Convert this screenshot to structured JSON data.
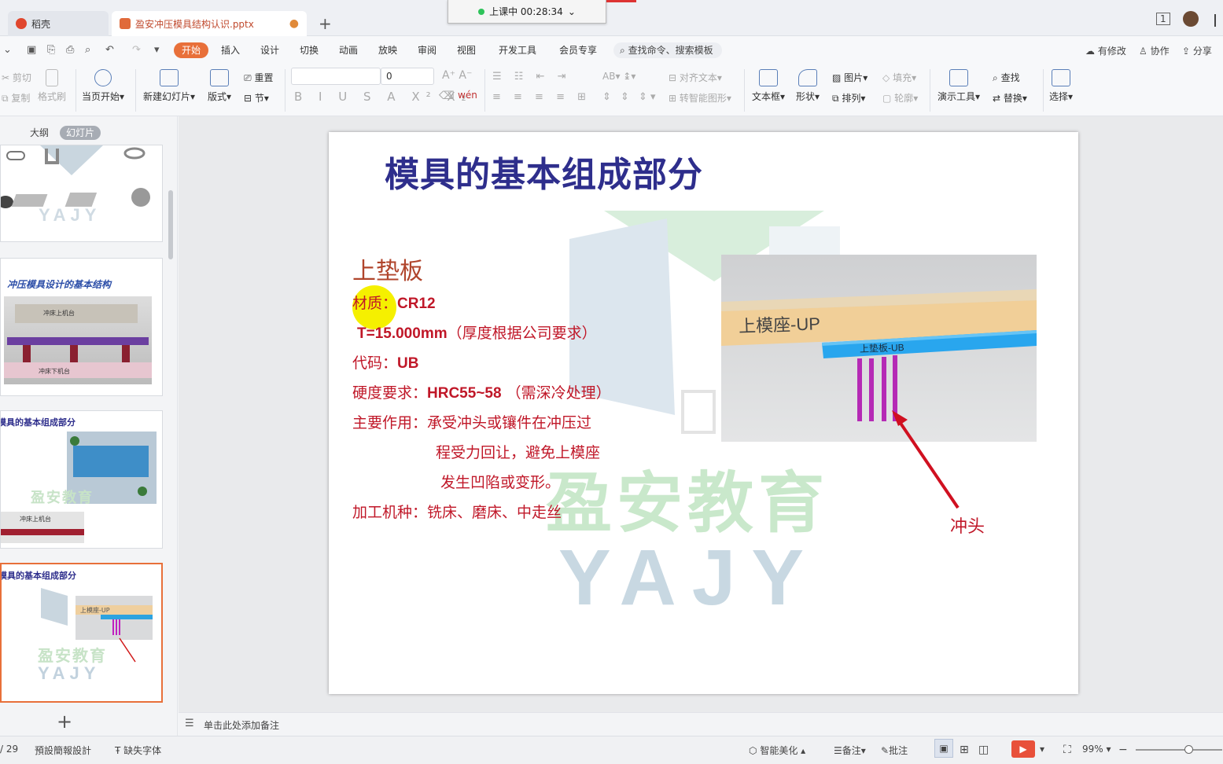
{
  "tabs": [
    {
      "label": "稻壳",
      "icon": "docer-icon",
      "color": "#e0462d"
    },
    {
      "label": "盈安冲压模具结构认识.pptx",
      "icon": "pptx-icon",
      "color": "#e06a3a"
    }
  ],
  "live": {
    "label": "上课中 00:28:34"
  },
  "window": {
    "badge": "1"
  },
  "menu": {
    "items": [
      "开始",
      "插入",
      "设计",
      "切换",
      "动画",
      "放映",
      "审阅",
      "视图",
      "开发工具",
      "会员专享"
    ],
    "active": "开始",
    "search_placeholder": "查找命令、搜索模板",
    "right": [
      "有修改",
      "协作",
      "分享"
    ]
  },
  "ribbon": {
    "cut": "剪切",
    "copy": "复制",
    "format_painter": "格式刷",
    "from_start": "当页开始",
    "new_slide": "新建幻灯片",
    "layout": "版式",
    "reset": "重置",
    "section": "节",
    "font_size": "0",
    "align_text": "对齐文本",
    "convert_smartart": "转智能图形",
    "textbox": "文本框",
    "shape": "形状",
    "picture": "图片",
    "arrange": "排列",
    "fill": "填充",
    "outline": "轮廓",
    "present_tools": "演示工具",
    "find": "查找",
    "replace": "替换",
    "select": "选择"
  },
  "panel": {
    "tab_outline": "大纲",
    "tab_slides": "幻灯片",
    "active_tab": "幻灯片"
  },
  "thumbs": {
    "t2_title": "冲压模具设计的基本结构",
    "t2_top": "冲床上机台",
    "t2_bottom": "冲床下机台",
    "t3_title": "模具的基本组成部分",
    "t3_inner": "冲床上机台",
    "t4_title": "模具的基本组成部分",
    "t4_label": "上模座-UP",
    "wm_small": "盈安教育",
    "wm_small_en": "YAJY"
  },
  "slide": {
    "title": "模具的基本组成部分",
    "subtitle": "上垫板",
    "material_label": "材质：",
    "material_value": "CR12",
    "thickness_value": "T=15.000mm",
    "thickness_note": "（厚度根据公司要求）",
    "code_label": "代码：",
    "code_value": "UB",
    "hardness_label": "硬度要求：",
    "hardness_value": "HRC55~58",
    "hardness_note": "（需深冷处理）",
    "function_label": "主要作用：",
    "function_line1": "承受冲头或镶件在冲压过",
    "function_line2": "程受力回让，避免上模座",
    "function_line3": "发生凹陷或变形。",
    "machining_label": "加工机种：",
    "machining_value": "铣床、磨床、中走丝",
    "image_label_upper": "上模座-UP",
    "image_label_plate": "上垫板-UB",
    "punch_label": "冲头",
    "watermark_cn": "盈安教育",
    "watermark_en": "YAJY"
  },
  "notes": {
    "placeholder": "单击此处添加备注"
  },
  "status": {
    "page": "/ 29",
    "theme": "預設簡報設計",
    "missing_font": "缺失字体",
    "beautify": "智能美化",
    "notes": "备注",
    "comments": "批注",
    "zoom": "99%"
  },
  "colors": {
    "accent": "#e8703a",
    "title": "#2e2e8c",
    "body": "#c01728",
    "subtitle": "#b0452c"
  }
}
